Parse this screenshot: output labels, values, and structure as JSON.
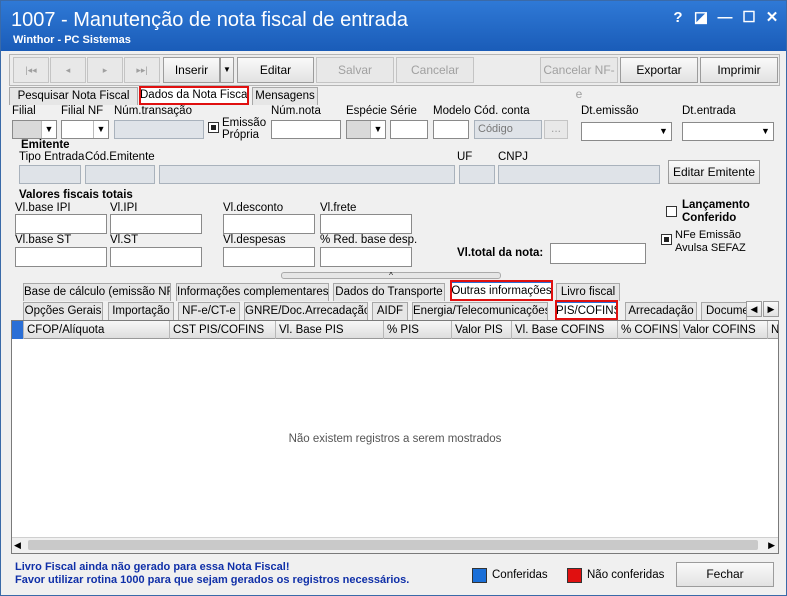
{
  "window": {
    "title": "1007 - Manutenção de nota fiscal de entrada",
    "subtitle": "Winthor - PC Sistemas",
    "controls": [
      "?",
      "◪",
      "—",
      "☐",
      "✕"
    ]
  },
  "toolbar": {
    "first": "|◂◂",
    "prev": "◂",
    "next": "▸",
    "last": "▸▸|",
    "inserir": "Inserir",
    "editar": "Editar",
    "salvar": "Salvar",
    "cancelar": "Cancelar",
    "cancelar_nfe": "Cancelar NF-e",
    "exportar": "Exportar",
    "imprimir": "Imprimir"
  },
  "main_tabs": [
    "Pesquisar Nota Fiscal",
    "Dados da Nota Fiscal",
    "Mensagens"
  ],
  "fields": {
    "filial": "Filial",
    "filial_nf": "Filial NF",
    "num_transacao": "Núm.transação",
    "emissao_propria_1": "Emissão",
    "emissao_propria_2": "Própria",
    "num_nota": "Núm.nota",
    "especie": "Espécie",
    "serie": "Série",
    "modelo": "Modelo",
    "cod_conta": "Cód. conta",
    "codigo_placeholder": "Código",
    "ellipsis": "...",
    "dt_emissao": "Dt.emissão",
    "dt_entrada": "Dt.entrada"
  },
  "emitente": {
    "section": "Emitente",
    "tipo_entrada": "Tipo Entrada",
    "cod_emitente": "Cód.Emitente",
    "uf": "UF",
    "cnpj": "CNPJ",
    "editar_button": "Editar Emitente"
  },
  "valores": {
    "section": "Valores fiscais totais",
    "vl_base_ipi": "Vl.base IPI",
    "vl_ipi": "Vl.IPI",
    "vl_desconto": "Vl.desconto",
    "vl_frete": "Vl.frete",
    "vl_base_st": "Vl.base ST",
    "vl_st": "Vl.ST",
    "vl_despesas": "Vl.despesas",
    "red_base": "% Red. base desp.",
    "vl_total": "Vl.total da nota:"
  },
  "side": {
    "lancamento_1": "Lançamento",
    "lancamento_2": "Conferido",
    "nfe_1": "NFe Emissão",
    "nfe_2": "Avulsa SEFAZ"
  },
  "sub_tabs": [
    "Base de cálculo (emissão NF)",
    "Informações complementares",
    "Dados do Transporte",
    "Outras informações",
    "Livro fiscal"
  ],
  "inner_tabs": [
    "Opções Gerais",
    "Importação",
    "NF-e/CT-e",
    "GNRE/Doc.Arrecadação",
    "AIDF",
    "Energia/Telecomunicações",
    "PIS/COFINS",
    "Arrecadação",
    "Docume"
  ],
  "grid": {
    "columns": [
      "CFOP/Alíquota",
      "CST PIS/COFINS",
      "Vl. Base PIS",
      "% PIS",
      "Valor PIS",
      "Vl. Base COFINS",
      "% COFINS",
      "Valor COFINS",
      "N"
    ],
    "empty_message": "Não existem registros a serem mostrados"
  },
  "footer": {
    "line1": "Livro Fiscal ainda não gerado para essa Nota Fiscal!",
    "line2": "Favor utilizar rotina 1000 para que sejam gerados os registros necessários.",
    "conferidas": "Conferidas",
    "nao_conferidas": "Não conferidas",
    "fechar": "Fechar",
    "conferidas_color": "#1a6fd8",
    "nao_conferidas_color": "#e01010"
  }
}
